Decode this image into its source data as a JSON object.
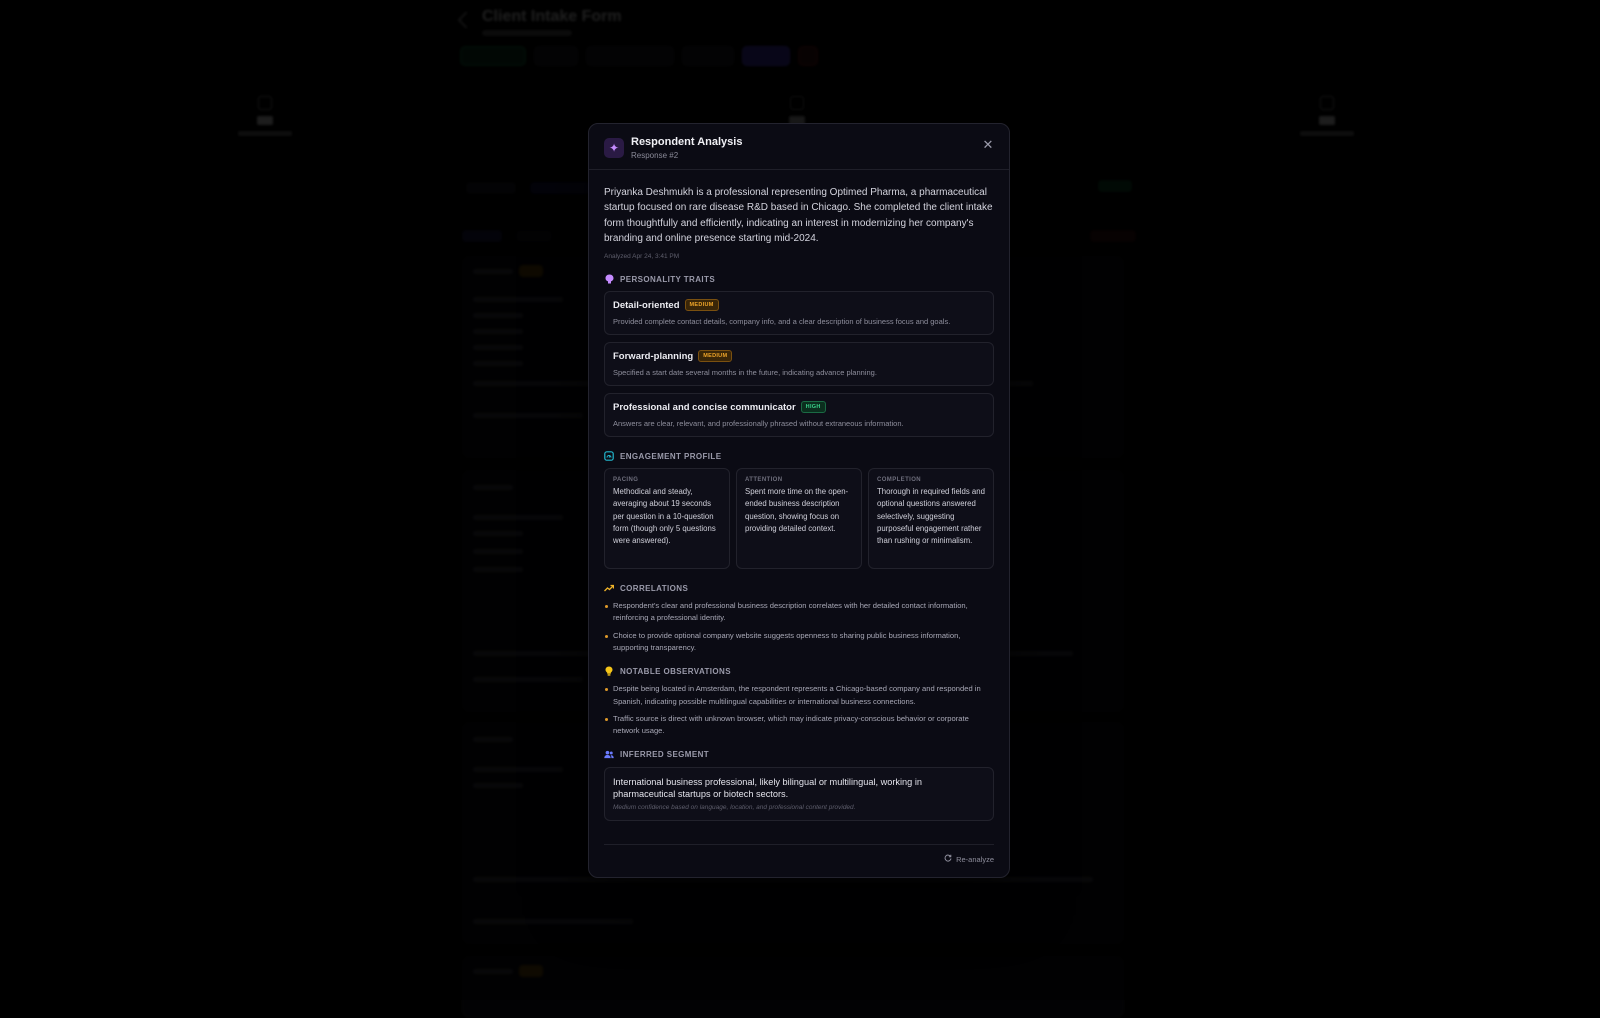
{
  "background": {
    "form_title": "Client Intake Form"
  },
  "modal": {
    "title": "Respondent Analysis",
    "subtitle": "Response #2",
    "icon": "sparkles-icon",
    "summary": "Priyanka Deshmukh is a professional representing Optimed Pharma, a pharmaceutical startup focused on rare disease R&D based in Chicago. She completed the client intake form thoughtfully and efficiently, indicating an interest in modernizing her company's branding and online presence starting mid-2024.",
    "analyzed": "Analyzed Apr 24, 3:41 PM",
    "sections": {
      "personality": "PERSONALITY TRAITS",
      "engagement": "ENGAGEMENT PROFILE",
      "correlations": "CORRELATIONS",
      "observations": "NOTABLE OBSERVATIONS",
      "segment": "INFERRED SEGMENT"
    },
    "traits": [
      {
        "name": "Detail-oriented",
        "level": "MEDIUM",
        "desc": "Provided complete contact details, company info, and a clear description of business focus and goals."
      },
      {
        "name": "Forward-planning",
        "level": "MEDIUM",
        "desc": "Specified a start date several months in the future, indicating advance planning."
      },
      {
        "name": "Professional and concise communicator",
        "level": "HIGH",
        "desc": "Answers are clear, relevant, and professionally phrased without extraneous information."
      }
    ],
    "engagement": [
      {
        "label": "PACING",
        "text": "Methodical and steady, averaging about 19 seconds per question in a 10-question form (though only 5 questions were answered)."
      },
      {
        "label": "ATTENTION",
        "text": "Spent more time on the open-ended business description question, showing focus on providing detailed context."
      },
      {
        "label": "COMPLETION",
        "text": "Thorough in required fields and optional questions answered selectively, suggesting purposeful engagement rather than rushing or minimalism."
      }
    ],
    "correlations": [
      "Respondent's clear and professional business description correlates with her detailed contact information, reinforcing a professional identity.",
      "Choice to provide optional company website suggests openness to sharing public business information, supporting transparency."
    ],
    "observations": [
      "Despite being located in Amsterdam, the respondent represents a Chicago-based company and responded in Spanish, indicating possible multilingual capabilities or international business connections.",
      "Traffic source is direct with unknown browser, which may indicate privacy-conscious behavior or corporate network usage."
    ],
    "segment": {
      "text": "International business professional, likely bilingual or multilingual, working in pharmaceutical startups or biotech sectors.",
      "note": "Medium confidence based on language, location, and professional content provided."
    },
    "reanalyze_label": "Re-analyze",
    "colors": {
      "accent_purple": "#c58bff",
      "medium": "#f0a62a",
      "high": "#3ad08a",
      "bullet": "#e09a2a"
    }
  }
}
